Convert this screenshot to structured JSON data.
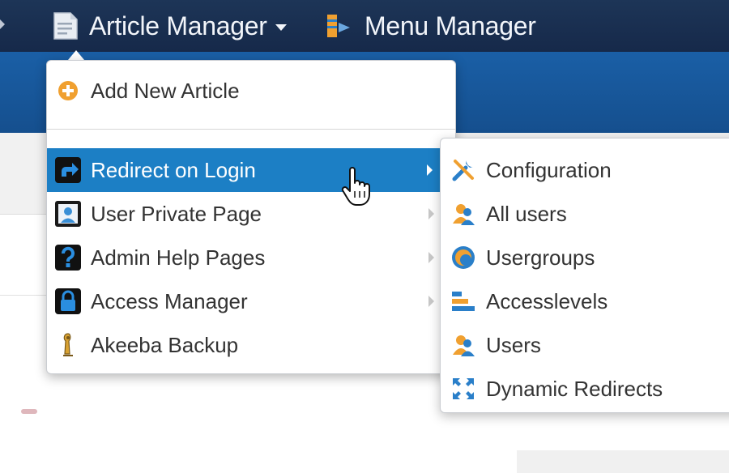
{
  "navbar": {
    "article_manager": "Article Manager",
    "menu_manager": "Menu Manager"
  },
  "dropdown": {
    "add_new_article": "Add New Article",
    "items": [
      {
        "label": "Redirect on Login",
        "icon": "redirect-icon",
        "active": true,
        "has_submenu": true
      },
      {
        "label": "User Private Page",
        "icon": "user-page-icon",
        "active": false,
        "has_submenu": true
      },
      {
        "label": "Admin Help Pages",
        "icon": "help-icon",
        "active": false,
        "has_submenu": true
      },
      {
        "label": "Access Manager",
        "icon": "lock-icon",
        "active": false,
        "has_submenu": true
      },
      {
        "label": "Akeeba Backup",
        "icon": "akeeba-icon",
        "active": false,
        "has_submenu": false
      }
    ]
  },
  "submenu": {
    "items": [
      {
        "label": "Configuration",
        "icon": "tools-icon"
      },
      {
        "label": "All users",
        "icon": "users-icon"
      },
      {
        "label": "Usergroups",
        "icon": "usergroups-icon"
      },
      {
        "label": "Accesslevels",
        "icon": "accesslevels-icon"
      },
      {
        "label": "Users",
        "icon": "users-icon"
      },
      {
        "label": "Dynamic Redirects",
        "icon": "expand-arrows-icon"
      }
    ]
  },
  "colors": {
    "navbar": "#1d3557",
    "active_item": "#1c7fc5",
    "accent_orange": "#f0a030"
  }
}
